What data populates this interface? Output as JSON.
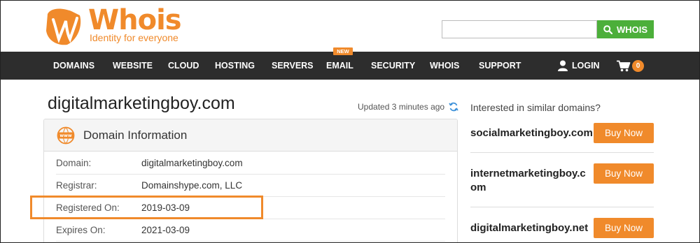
{
  "logo": {
    "name": "Whois",
    "tagline": "Identity for everyone"
  },
  "search": {
    "value": "",
    "placeholder": "",
    "button_label": "WHOIS"
  },
  "nav": {
    "items": [
      "DOMAINS",
      "WEBSITE",
      "CLOUD",
      "HOSTING",
      "SERVERS",
      "EMAIL",
      "SECURITY",
      "WHOIS",
      "SUPPORT"
    ],
    "new_badge": "NEW",
    "login_label": "LOGIN",
    "cart_count": "0"
  },
  "main": {
    "domain_title": "digitalmarketingboy.com",
    "updated_text": "Updated 3 minutes ago",
    "card_title": "Domain Information",
    "rows": [
      {
        "label": "Domain:",
        "value": "digitalmarketingboy.com"
      },
      {
        "label": "Registrar:",
        "value": "Domainshype.com, LLC"
      },
      {
        "label": "Registered On:",
        "value": "2019-03-09"
      },
      {
        "label": "Expires On:",
        "value": "2021-03-09"
      }
    ]
  },
  "sidebar": {
    "heading": "Interested in similar domains?",
    "suggestions": [
      {
        "name": "socialmarketingboy.com",
        "button": "Buy Now"
      },
      {
        "name": "internetmarketingboy.com",
        "button": "Buy Now"
      },
      {
        "name": "digitalmarketingboy.net",
        "button": "Buy Now"
      }
    ]
  },
  "colors": {
    "brand_orange": "#f08a2b",
    "search_green": "#4caf3a",
    "nav_dark": "#2d2d2d"
  },
  "icons": [
    "whois-logo-icon",
    "search-icon",
    "user-icon",
    "cart-icon",
    "refresh-icon",
    "www-globe-icon"
  ]
}
